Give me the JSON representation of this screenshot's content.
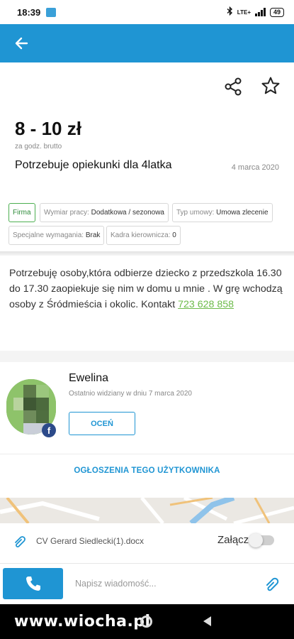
{
  "status_bar": {
    "time": "18:39",
    "network": "LTE+",
    "battery": "49"
  },
  "offer": {
    "price": "8 - 10 zł",
    "price_note": "za godz. brutto",
    "title": "Potrzebuje opiekunki dla 4latka",
    "date": "4 marca 2020",
    "tags": {
      "firma": "Firma",
      "wymiar_label": "Wymiar pracy:",
      "wymiar_value": "Dodatkowa / sezonowa",
      "umowa_label": "Typ umowy:",
      "umowa_value": "Umowa zlecenie",
      "wymagania_label": "Specjalne wymagania:",
      "wymagania_value": "Brak",
      "kadra_label": "Kadra kierownicza:",
      "kadra_value": "0"
    },
    "description": "Potrzebuję osoby,która odbierze dziecko z przedszkola 16.30 do 17.30 zaopiekuje się nim w domu u mnie . W grę wchodzą osoby z Śródmieścia i okolic. Kontakt ",
    "phone": "723 628 858"
  },
  "user": {
    "name": "Ewelina",
    "last_seen": "Ostatnio widziany w dniu 7 marca 2020",
    "rate_button": "OCEŃ",
    "ads_link": "OGŁOSZENIA TEGO UŻYTKOWNIKA"
  },
  "attachment": {
    "file_name": "CV Gerard Siedlecki(1).docx",
    "attach_label": "Załącz",
    "attach_enabled": false
  },
  "message": {
    "placeholder": "Napisz wiadomość..."
  },
  "watermark": "www.wiocha.pl",
  "colors": {
    "accent": "#1f95d3",
    "green": "#4caf50",
    "link": "#6dbb4a"
  }
}
